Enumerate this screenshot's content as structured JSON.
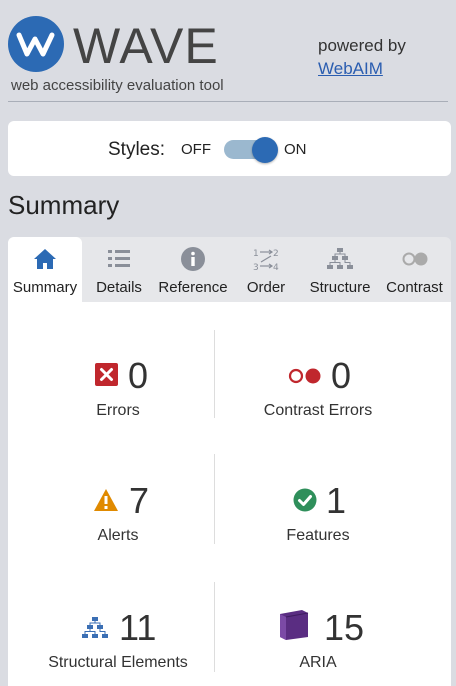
{
  "header": {
    "logo_text": "WAVE",
    "tagline": "web accessibility evaluation tool",
    "powered_by": "powered by",
    "webaim_link": "WebAIM"
  },
  "styles": {
    "label": "Styles:",
    "off": "OFF",
    "on": "ON",
    "state": "on"
  },
  "section_title": "Summary",
  "tabs": [
    {
      "label": "Summary",
      "icon": "home-icon",
      "active": true
    },
    {
      "label": "Details",
      "icon": "list-icon",
      "active": false
    },
    {
      "label": "Reference",
      "icon": "info-icon",
      "active": false
    },
    {
      "label": "Order",
      "icon": "order-icon",
      "active": false
    },
    {
      "label": "Structure",
      "icon": "structure-icon",
      "active": false
    },
    {
      "label": "Contrast",
      "icon": "contrast-icon",
      "active": false
    }
  ],
  "summary": {
    "errors": {
      "count": "0",
      "label": "Errors"
    },
    "contrast_errors": {
      "count": "0",
      "label": "Contrast Errors"
    },
    "alerts": {
      "count": "7",
      "label": "Alerts"
    },
    "features": {
      "count": "1",
      "label": "Features"
    },
    "structural": {
      "count": "11",
      "label": "Structural Elements"
    },
    "aria": {
      "count": "15",
      "label": "ARIA"
    }
  },
  "colors": {
    "brand_blue": "#2c6ab4",
    "error_red": "#c0272d",
    "alert_orange": "#e08a00",
    "feature_green": "#2f8f5b",
    "aria_purple": "#5a2d82",
    "structure_blue": "#3b6fb4"
  }
}
